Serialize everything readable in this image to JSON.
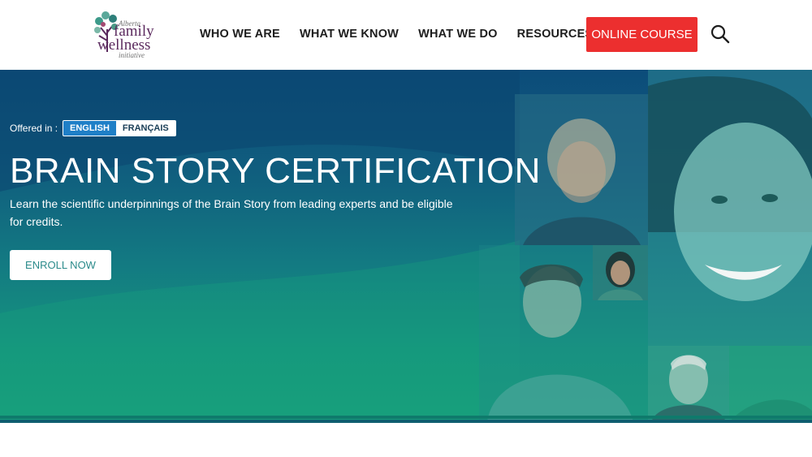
{
  "logo": {
    "top": "Alberta",
    "line1": "family",
    "line2": "wellness",
    "bottom": "initiative"
  },
  "nav": {
    "items": [
      {
        "label": "WHO WE ARE"
      },
      {
        "label": "WHAT WE KNOW"
      },
      {
        "label": "WHAT WE DO"
      },
      {
        "label": "RESOURCES"
      }
    ],
    "cta_label": "ONLINE COURSE",
    "search_icon": "search-icon"
  },
  "hero": {
    "offered_label": "Offered in :",
    "languages": [
      {
        "label": "ENGLISH",
        "active": true
      },
      {
        "label": "FRANÇAIS",
        "active": false
      }
    ],
    "title": "BRAIN STORY CERTIFICATION",
    "description": "Learn the scientific underpinnings of the Brain Story from leading experts and be eligible for credits.",
    "enroll_label": "ENROLL NOW"
  },
  "colors": {
    "brand_purple": "#5b2a5e",
    "cta_red": "#ec2f2f",
    "hero_top": "#0c4c7a",
    "hero_bottom": "#18a07b",
    "active_lang": "#1f7fc7"
  }
}
